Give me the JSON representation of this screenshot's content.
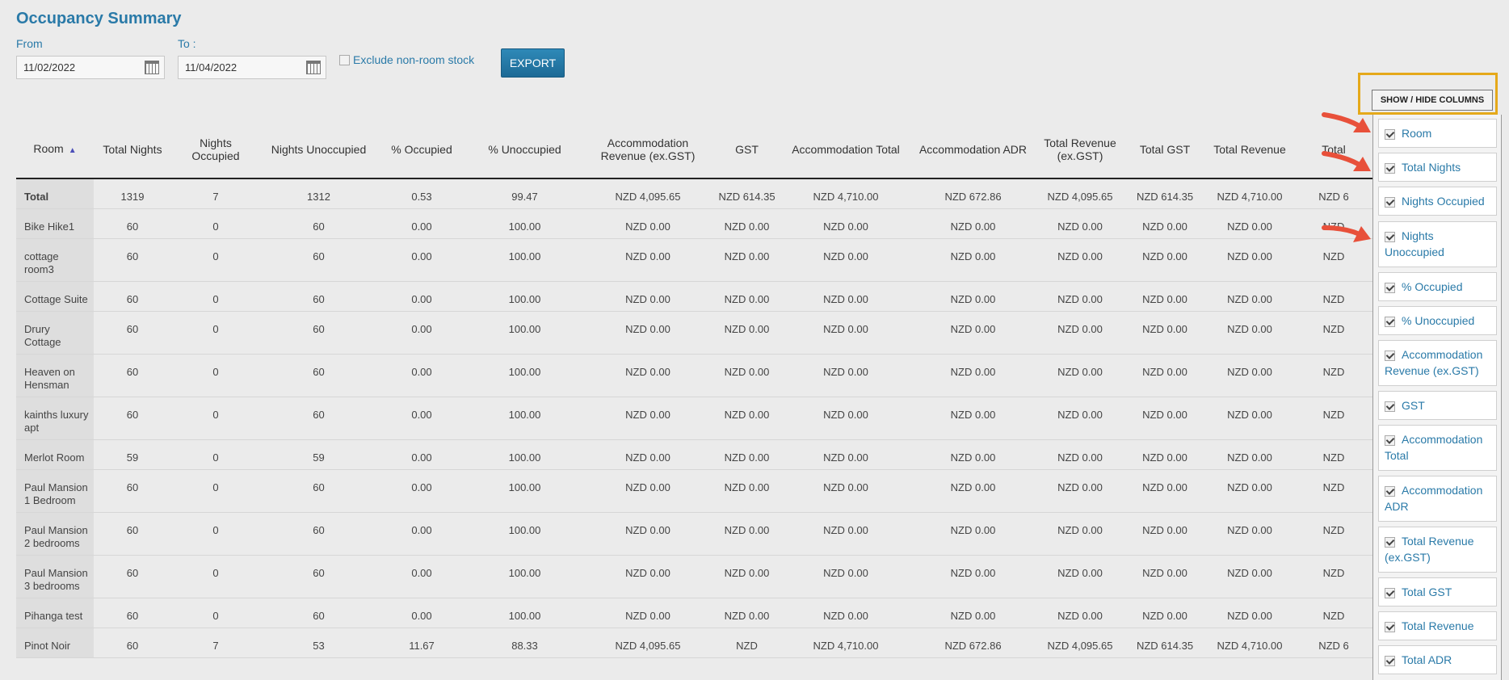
{
  "page": {
    "title": "Occupancy Summary"
  },
  "filters": {
    "from_label": "From",
    "to_label": "To :",
    "from_value": "11/02/2022",
    "to_value": "11/04/2022",
    "exclude_label": "Exclude non-room stock",
    "export_label": "EXPORT"
  },
  "table": {
    "headers": [
      "Room",
      "Total Nights",
      "Nights Occupied",
      "Nights Unoccupied",
      "% Occupied",
      "% Unoccupied",
      "Accommodation Revenue (ex.GST)",
      "GST",
      "Accommodation Total",
      "Accommodation ADR",
      "Total Revenue (ex.GST)",
      "Total GST",
      "Total Revenue",
      "Total"
    ],
    "rows": [
      {
        "room": "Total",
        "total_nights": "1319",
        "occupied": "7",
        "unoccupied": "1312",
        "pct_occ": "0.53",
        "pct_unocc": "99.47",
        "acc_rev": "NZD 4,095.65",
        "gst": "NZD 614.35",
        "acc_total": "NZD 4,710.00",
        "acc_adr": "NZD 672.86",
        "tot_rev_ex": "NZD 4,095.65",
        "tot_gst": "NZD 614.35",
        "tot_rev": "NZD 4,710.00",
        "tot_adr": "NZD 6"
      },
      {
        "room": "Bike Hike1",
        "total_nights": "60",
        "occupied": "0",
        "unoccupied": "60",
        "pct_occ": "0.00",
        "pct_unocc": "100.00",
        "acc_rev": "NZD 0.00",
        "gst": "NZD 0.00",
        "acc_total": "NZD 0.00",
        "acc_adr": "NZD 0.00",
        "tot_rev_ex": "NZD 0.00",
        "tot_gst": "NZD 0.00",
        "tot_rev": "NZD 0.00",
        "tot_adr": "NZD"
      },
      {
        "room": "cottage room3",
        "total_nights": "60",
        "occupied": "0",
        "unoccupied": "60",
        "pct_occ": "0.00",
        "pct_unocc": "100.00",
        "acc_rev": "NZD 0.00",
        "gst": "NZD 0.00",
        "acc_total": "NZD 0.00",
        "acc_adr": "NZD 0.00",
        "tot_rev_ex": "NZD 0.00",
        "tot_gst": "NZD 0.00",
        "tot_rev": "NZD 0.00",
        "tot_adr": "NZD"
      },
      {
        "room": "Cottage Suite",
        "total_nights": "60",
        "occupied": "0",
        "unoccupied": "60",
        "pct_occ": "0.00",
        "pct_unocc": "100.00",
        "acc_rev": "NZD 0.00",
        "gst": "NZD 0.00",
        "acc_total": "NZD 0.00",
        "acc_adr": "NZD 0.00",
        "tot_rev_ex": "NZD 0.00",
        "tot_gst": "NZD 0.00",
        "tot_rev": "NZD 0.00",
        "tot_adr": "NZD"
      },
      {
        "room": "Drury Cottage",
        "total_nights": "60",
        "occupied": "0",
        "unoccupied": "60",
        "pct_occ": "0.00",
        "pct_unocc": "100.00",
        "acc_rev": "NZD 0.00",
        "gst": "NZD 0.00",
        "acc_total": "NZD 0.00",
        "acc_adr": "NZD 0.00",
        "tot_rev_ex": "NZD 0.00",
        "tot_gst": "NZD 0.00",
        "tot_rev": "NZD 0.00",
        "tot_adr": "NZD"
      },
      {
        "room": "Heaven on Hensman",
        "total_nights": "60",
        "occupied": "0",
        "unoccupied": "60",
        "pct_occ": "0.00",
        "pct_unocc": "100.00",
        "acc_rev": "NZD 0.00",
        "gst": "NZD 0.00",
        "acc_total": "NZD 0.00",
        "acc_adr": "NZD 0.00",
        "tot_rev_ex": "NZD 0.00",
        "tot_gst": "NZD 0.00",
        "tot_rev": "NZD 0.00",
        "tot_adr": "NZD"
      },
      {
        "room": "kainths luxury apt",
        "total_nights": "60",
        "occupied": "0",
        "unoccupied": "60",
        "pct_occ": "0.00",
        "pct_unocc": "100.00",
        "acc_rev": "NZD 0.00",
        "gst": "NZD 0.00",
        "acc_total": "NZD 0.00",
        "acc_adr": "NZD 0.00",
        "tot_rev_ex": "NZD 0.00",
        "tot_gst": "NZD 0.00",
        "tot_rev": "NZD 0.00",
        "tot_adr": "NZD"
      },
      {
        "room": "Merlot Room",
        "total_nights": "59",
        "occupied": "0",
        "unoccupied": "59",
        "pct_occ": "0.00",
        "pct_unocc": "100.00",
        "acc_rev": "NZD 0.00",
        "gst": "NZD 0.00",
        "acc_total": "NZD 0.00",
        "acc_adr": "NZD 0.00",
        "tot_rev_ex": "NZD 0.00",
        "tot_gst": "NZD 0.00",
        "tot_rev": "NZD 0.00",
        "tot_adr": "NZD"
      },
      {
        "room": "Paul Mansion 1 Bedroom",
        "total_nights": "60",
        "occupied": "0",
        "unoccupied": "60",
        "pct_occ": "0.00",
        "pct_unocc": "100.00",
        "acc_rev": "NZD 0.00",
        "gst": "NZD 0.00",
        "acc_total": "NZD 0.00",
        "acc_adr": "NZD 0.00",
        "tot_rev_ex": "NZD 0.00",
        "tot_gst": "NZD 0.00",
        "tot_rev": "NZD 0.00",
        "tot_adr": "NZD"
      },
      {
        "room": "Paul Mansion 2 bedrooms",
        "total_nights": "60",
        "occupied": "0",
        "unoccupied": "60",
        "pct_occ": "0.00",
        "pct_unocc": "100.00",
        "acc_rev": "NZD 0.00",
        "gst": "NZD 0.00",
        "acc_total": "NZD 0.00",
        "acc_adr": "NZD 0.00",
        "tot_rev_ex": "NZD 0.00",
        "tot_gst": "NZD 0.00",
        "tot_rev": "NZD 0.00",
        "tot_adr": "NZD"
      },
      {
        "room": "Paul Mansion 3 bedrooms",
        "total_nights": "60",
        "occupied": "0",
        "unoccupied": "60",
        "pct_occ": "0.00",
        "pct_unocc": "100.00",
        "acc_rev": "NZD 0.00",
        "gst": "NZD 0.00",
        "acc_total": "NZD 0.00",
        "acc_adr": "NZD 0.00",
        "tot_rev_ex": "NZD 0.00",
        "tot_gst": "NZD 0.00",
        "tot_rev": "NZD 0.00",
        "tot_adr": "NZD"
      },
      {
        "room": "Pihanga test",
        "total_nights": "60",
        "occupied": "0",
        "unoccupied": "60",
        "pct_occ": "0.00",
        "pct_unocc": "100.00",
        "acc_rev": "NZD 0.00",
        "gst": "NZD 0.00",
        "acc_total": "NZD 0.00",
        "acc_adr": "NZD 0.00",
        "tot_rev_ex": "NZD 0.00",
        "tot_gst": "NZD 0.00",
        "tot_rev": "NZD 0.00",
        "tot_adr": "NZD"
      },
      {
        "room": "Pinot Noir",
        "total_nights": "60",
        "occupied": "7",
        "unoccupied": "53",
        "pct_occ": "11.67",
        "pct_unocc": "88.33",
        "acc_rev": "NZD 4,095.65",
        "gst": "NZD",
        "acc_total": "NZD 4,710.00",
        "acc_adr": "NZD 672.86",
        "tot_rev_ex": "NZD 4,095.65",
        "tot_gst": "NZD 614.35",
        "tot_rev": "NZD 4,710.00",
        "tot_adr": "NZD 6"
      }
    ]
  },
  "column_panel": {
    "button_label": "SHOW / HIDE COLUMNS",
    "items": [
      "Room",
      "Total Nights",
      "Nights Occupied",
      "Nights Unoccupied",
      "% Occupied",
      "% Unoccupied",
      "Accommodation Revenue (ex.GST)",
      "GST",
      "Accommodation Total",
      "Accommodation ADR",
      "Total Revenue (ex.GST)",
      "Total GST",
      "Total Revenue",
      "Total ADR"
    ]
  },
  "colors": {
    "accent": "#2a7aa8",
    "highlight": "#e5a91a",
    "arrow": "#e8503a"
  }
}
